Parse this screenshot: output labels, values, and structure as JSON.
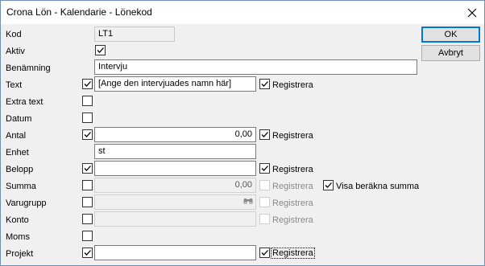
{
  "window": {
    "title": "Crona Lön - Kalendarie - Lönekod"
  },
  "buttons": {
    "ok": "OK",
    "cancel": "Avbryt"
  },
  "fields": {
    "kod": {
      "label": "Kod",
      "value": "LT1"
    },
    "aktiv": {
      "label": "Aktiv",
      "checked": true
    },
    "benamning": {
      "label": "Benämning",
      "value": "Intervju"
    },
    "text": {
      "label": "Text",
      "checked": true,
      "value": "[Ange den intervjuades namn här]",
      "register_label": "Registrera",
      "register_checked": true
    },
    "extra_text": {
      "label": "Extra text",
      "checked": false
    },
    "datum": {
      "label": "Datum",
      "checked": false
    },
    "antal": {
      "label": "Antal",
      "checked": true,
      "value": "0,00",
      "register_label": "Registrera",
      "register_checked": true
    },
    "enhet": {
      "label": "Enhet",
      "value": "st"
    },
    "belopp": {
      "label": "Belopp",
      "checked": true,
      "value": "",
      "register_label": "Registrera",
      "register_checked": true
    },
    "summa": {
      "label": "Summa",
      "checked": false,
      "value": "0,00",
      "register_label": "Registrera",
      "register_checked": false,
      "show_calc_label": "Visa beräkna summa",
      "show_calc_checked": true
    },
    "varugrupp": {
      "label": "Varugrupp",
      "checked": false,
      "value": "",
      "register_label": "Registrera",
      "register_checked": false
    },
    "konto": {
      "label": "Konto",
      "checked": false,
      "value": "",
      "register_label": "Registrera",
      "register_checked": false
    },
    "moms": {
      "label": "Moms",
      "checked": false
    },
    "projekt": {
      "label": "Projekt",
      "checked": true,
      "value": "",
      "register_label": "Registrera",
      "register_checked": true
    }
  }
}
